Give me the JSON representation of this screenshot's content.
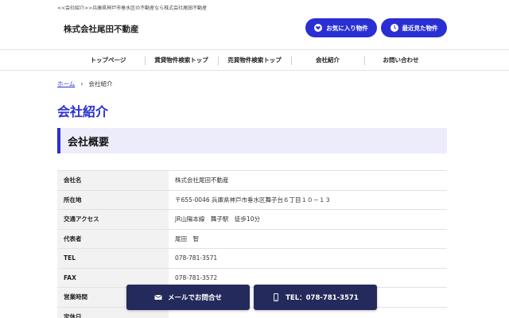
{
  "topline": "<<会社紹介>>兵庫県神戸市垂水区の不動産なら株式会社尾田不動産",
  "logo": "株式会社尾田不動産",
  "header_buttons": {
    "favorites": "お気に入り物件",
    "recent": "最近見た物件"
  },
  "nav": {
    "items": [
      {
        "label": "トップページ"
      },
      {
        "label": "賃貸物件検索トップ"
      },
      {
        "label": "売買物件検索トップ"
      },
      {
        "label": "会社紹介"
      },
      {
        "label": "お問い合わせ"
      }
    ]
  },
  "breadcrumb": {
    "home": "ホーム",
    "separator": "›",
    "current": "会社紹介"
  },
  "page_title": "会社紹介",
  "section_heading": "会社概要",
  "company_table": [
    {
      "label": "会社名",
      "value": "株式会社尾田不動産"
    },
    {
      "label": "所在地",
      "value": "〒655-0046 兵庫県神戸市垂水区舞子台６丁目１０－１３"
    },
    {
      "label": "交通アクセス",
      "value": "JR山陽本線　舞子駅　徒歩10分"
    },
    {
      "label": "代表者",
      "value": "尾田　智"
    },
    {
      "label": "TEL",
      "value": "078-781-3571"
    },
    {
      "label": "FAX",
      "value": "078-781-3572"
    },
    {
      "label": "営業時間",
      "value": ""
    },
    {
      "label": "定休日",
      "value": ""
    }
  ],
  "floating": {
    "mail": "メールでお問合せ",
    "tel": "TEL：078-781-3571"
  },
  "colors": {
    "accent": "#2a2fd4",
    "floating_bg": "#252a5c",
    "section_bg": "#ececfb"
  }
}
